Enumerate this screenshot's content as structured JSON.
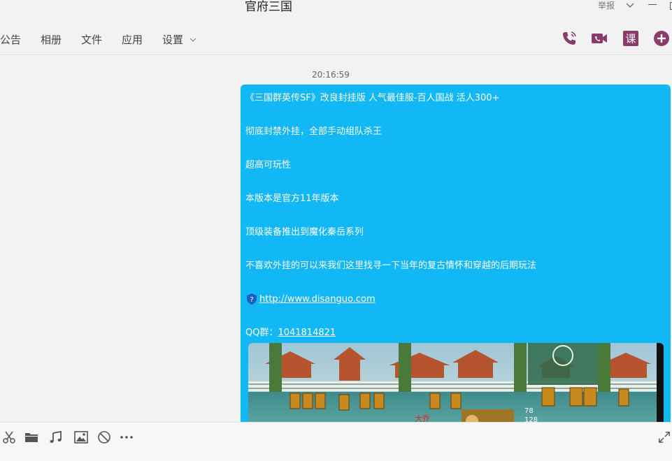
{
  "window": {
    "title": "官府三国",
    "report_label": "举报"
  },
  "tabs": [
    {
      "label": "公告"
    },
    {
      "label": "相册"
    },
    {
      "label": "文件"
    },
    {
      "label": "应用"
    },
    {
      "label": "设置"
    }
  ],
  "toolbar_icons": [
    "phone-icon",
    "video-call-icon",
    "class-icon",
    "add-icon"
  ],
  "toolbar_class_label": "课",
  "chat": {
    "timestamp": "20:16:59",
    "message": {
      "lines": [
        "《三国群英传SF》改良封挂版 人气最佳服-百人国战 活人300+",
        "彻底封禁外挂，全部手动组队杀王",
        "超高可玩性",
        "本版本是官方11年版本",
        "顶级装备推出到魔化秦岳系列",
        "不喜欢外挂的可以来我们这里找寻一下当年的复古情怀和穿越的后期玩法"
      ],
      "link": "http://www.disanguo.com",
      "qq_prefix": "QQ群：",
      "qq_number": "1041814821"
    }
  },
  "input_icons": [
    "scissors-icon",
    "folder-icon",
    "music-icon",
    "image-icon",
    "block-icon",
    "more-icon",
    "expand-icon"
  ],
  "colors": {
    "bubble": "#12b7f5",
    "accent": "#8a3a6b",
    "background": "#f2f2f2"
  }
}
